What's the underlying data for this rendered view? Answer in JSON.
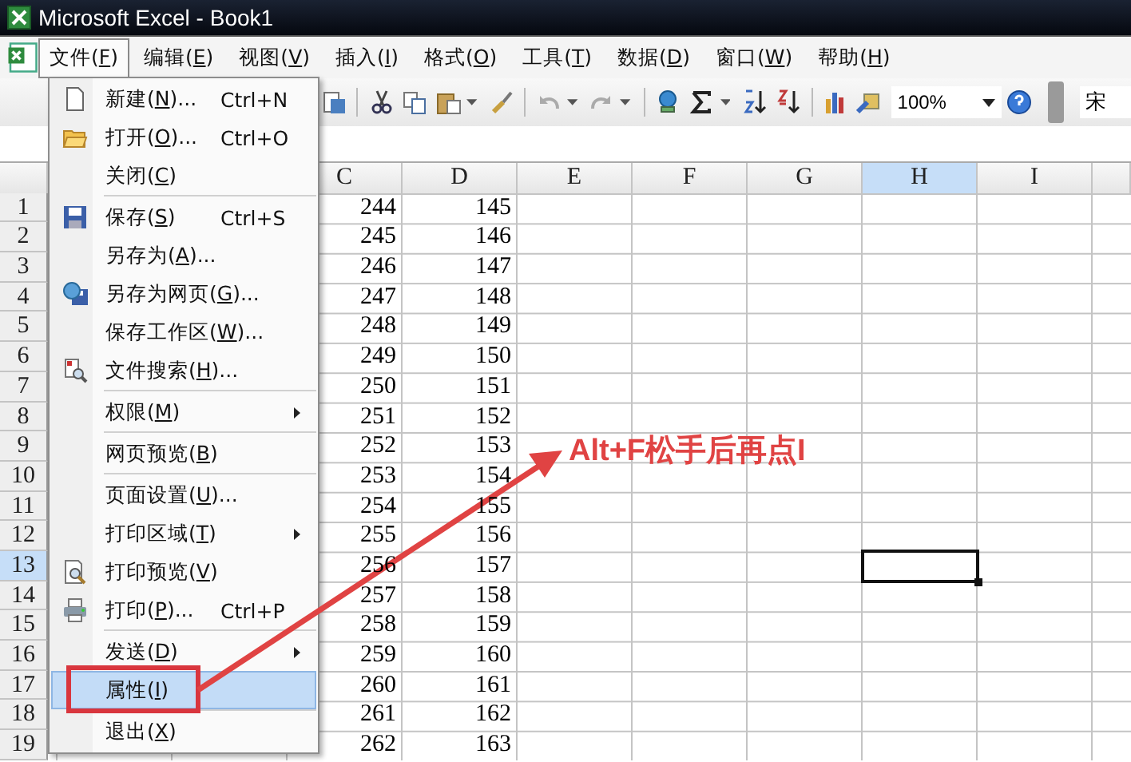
{
  "window": {
    "title": "Microsoft Excel - Book1"
  },
  "menu_bar": [
    {
      "label": "文件(F)",
      "selected": true
    },
    {
      "label": "编辑(E)",
      "selected": false
    },
    {
      "label": "视图(V)",
      "selected": false
    },
    {
      "label": "插入(I)",
      "selected": false
    },
    {
      "label": "格式(O)",
      "selected": false
    },
    {
      "label": "工具(T)",
      "selected": false
    },
    {
      "label": "数据(D)",
      "selected": false
    },
    {
      "label": "窗口(W)",
      "selected": false
    },
    {
      "label": "帮助(H)",
      "selected": false
    }
  ],
  "toolbar": {
    "zoom": "100%",
    "font": "宋"
  },
  "file_menu": {
    "items": [
      {
        "kind": "item",
        "label": "新建(N)...",
        "shortcut": "Ctrl+N",
        "submenu": false,
        "selected": false
      },
      {
        "kind": "item",
        "label": "打开(O)...",
        "shortcut": "Ctrl+O",
        "submenu": false,
        "selected": false
      },
      {
        "kind": "item",
        "label": "关闭(C)",
        "submenu": false,
        "selected": false
      },
      {
        "kind": "separator"
      },
      {
        "kind": "item",
        "label": "保存(S)",
        "shortcut": "Ctrl+S",
        "submenu": false,
        "selected": false
      },
      {
        "kind": "item",
        "label": "另存为(A)...",
        "submenu": false,
        "selected": false
      },
      {
        "kind": "item",
        "label": "另存为网页(G)...",
        "submenu": false,
        "selected": false
      },
      {
        "kind": "item",
        "label": "保存工作区(W)...",
        "submenu": false,
        "selected": false
      },
      {
        "kind": "item",
        "label": "文件搜索(H)...",
        "submenu": false,
        "selected": false
      },
      {
        "kind": "separator"
      },
      {
        "kind": "item",
        "label": "权限(M)",
        "submenu": true,
        "selected": false
      },
      {
        "kind": "separator"
      },
      {
        "kind": "item",
        "label": "网页预览(B)",
        "submenu": false,
        "selected": false
      },
      {
        "kind": "separator"
      },
      {
        "kind": "item",
        "label": "页面设置(U)...",
        "submenu": false,
        "selected": false
      },
      {
        "kind": "item",
        "label": "打印区域(T)",
        "submenu": true,
        "selected": false
      },
      {
        "kind": "item",
        "label": "打印预览(V)",
        "submenu": false,
        "selected": false
      },
      {
        "kind": "item",
        "label": "打印(P)...",
        "shortcut": "Ctrl+P",
        "submenu": false,
        "selected": false
      },
      {
        "kind": "separator"
      },
      {
        "kind": "item",
        "label": "发送(D)",
        "submenu": true,
        "selected": false
      },
      {
        "kind": "item",
        "label": "属性(I)",
        "submenu": false,
        "selected": true
      },
      {
        "kind": "separator"
      },
      {
        "kind": "item",
        "label": "退出(X)",
        "submenu": false,
        "selected": false
      }
    ]
  },
  "sheet": {
    "columns": [
      {
        "label": "C",
        "selected": false
      },
      {
        "label": "D",
        "selected": false
      },
      {
        "label": "E",
        "selected": false
      },
      {
        "label": "F",
        "selected": false
      },
      {
        "label": "G",
        "selected": false
      },
      {
        "label": "H",
        "selected": true
      },
      {
        "label": "I",
        "selected": false
      }
    ],
    "rows": [
      {
        "label": "1",
        "selected": false,
        "cells": [
          "244",
          "145"
        ]
      },
      {
        "label": "2",
        "selected": false,
        "cells": [
          "245",
          "146"
        ]
      },
      {
        "label": "3",
        "selected": false,
        "cells": [
          "246",
          "147"
        ]
      },
      {
        "label": "4",
        "selected": false,
        "cells": [
          "247",
          "148"
        ]
      },
      {
        "label": "5",
        "selected": false,
        "cells": [
          "248",
          "149"
        ]
      },
      {
        "label": "6",
        "selected": false,
        "cells": [
          "249",
          "150"
        ]
      },
      {
        "label": "7",
        "selected": false,
        "cells": [
          "250",
          "151"
        ]
      },
      {
        "label": "8",
        "selected": false,
        "cells": [
          "251",
          "152"
        ]
      },
      {
        "label": "9",
        "selected": false,
        "cells": [
          "252",
          "153"
        ]
      },
      {
        "label": "10",
        "selected": false,
        "cells": [
          "253",
          "154"
        ]
      },
      {
        "label": "11",
        "selected": false,
        "cells": [
          "254",
          "155"
        ]
      },
      {
        "label": "12",
        "selected": false,
        "cells": [
          "255",
          "156"
        ]
      },
      {
        "label": "13",
        "selected": true,
        "cells": [
          "256",
          "157"
        ]
      },
      {
        "label": "14",
        "selected": false,
        "cells": [
          "257",
          "158"
        ]
      },
      {
        "label": "15",
        "selected": false,
        "cells": [
          "258",
          "159"
        ]
      },
      {
        "label": "16",
        "selected": false,
        "cells": [
          "259",
          "160"
        ]
      },
      {
        "label": "17",
        "selected": false,
        "cells": [
          "260",
          "161"
        ]
      },
      {
        "label": "18",
        "selected": false,
        "cells": [
          "261",
          "162"
        ]
      },
      {
        "label": "19",
        "selected": false,
        "cells": [
          "262",
          "163"
        ]
      }
    ]
  },
  "annotation": {
    "note": "Alt+F松手后再点I"
  }
}
